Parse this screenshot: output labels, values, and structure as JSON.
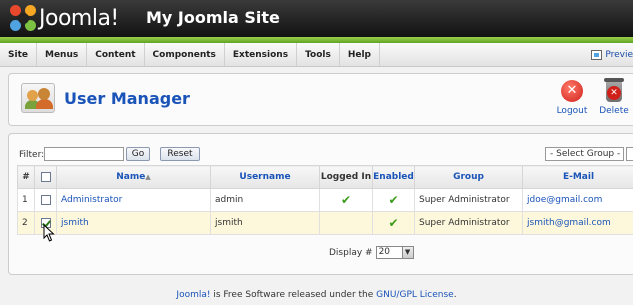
{
  "header": {
    "logo_text": "Joomla!",
    "site_title": "My Joomla Site"
  },
  "menu": {
    "items": [
      "Site",
      "Menus",
      "Content",
      "Components",
      "Extensions",
      "Tools",
      "Help"
    ],
    "preview_label": "Previe"
  },
  "toolbar": {
    "title": "User Manager",
    "logout_label": "Logout",
    "delete_label": "Delete"
  },
  "filter": {
    "label": "Filter:",
    "value": "",
    "go_label": "Go",
    "reset_label": "Reset",
    "group_select": "- Select Group -"
  },
  "table": {
    "columns": [
      "#",
      "",
      "Name",
      "Username",
      "Logged In",
      "Enabled",
      "Group",
      "E-Mail"
    ],
    "rows": [
      {
        "num": "1",
        "checked": false,
        "name": "Administrator",
        "username": "admin",
        "logged_in": true,
        "enabled": true,
        "group": "Super Administrator",
        "email": "jdoe@gmail.com"
      },
      {
        "num": "2",
        "checked": true,
        "name": "jsmith",
        "username": "jsmith",
        "logged_in": false,
        "enabled": true,
        "group": "Super Administrator",
        "email": "jsmith@gmail.com"
      }
    ]
  },
  "pagination": {
    "display_label": "Display #",
    "display_value": "20"
  },
  "footer": {
    "joomla_link": "Joomla!",
    "text_middle": " is Free Software released under the ",
    "license_link": "GNU/GPL License",
    "text_end": "."
  }
}
